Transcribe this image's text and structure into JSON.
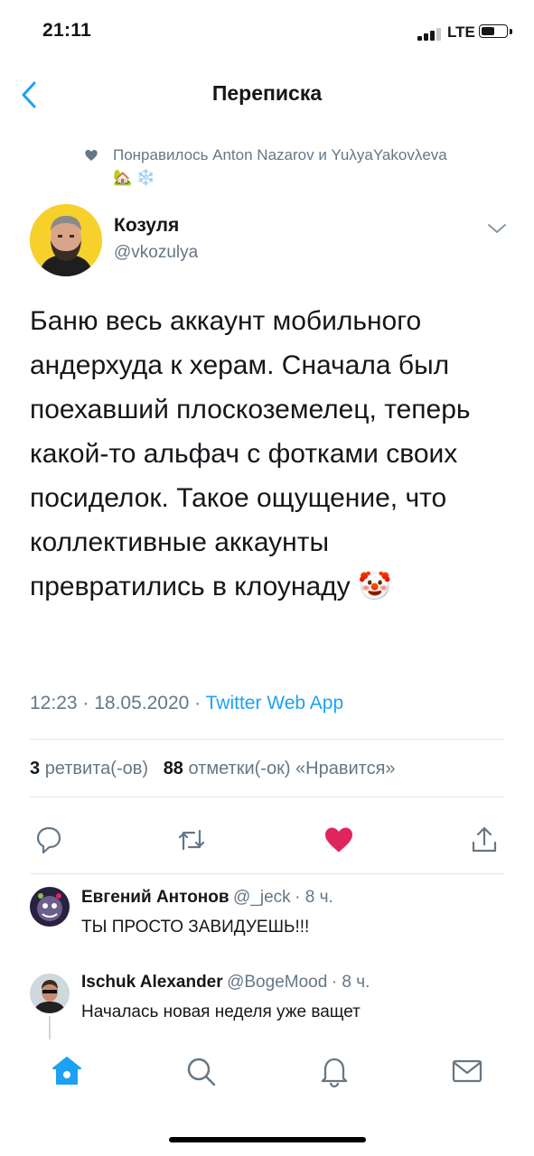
{
  "status_bar": {
    "time": "21:11",
    "network": "LTE",
    "signal_bars": 3,
    "battery_level": 0.55
  },
  "nav": {
    "back_icon": "chevron-left-icon",
    "title": "Переписка"
  },
  "liked_by": {
    "text": "Понравилось Anton Nazarov и YuλyaYakovλeva 🏡 ❄️",
    "icon": "heart-icon"
  },
  "tweet": {
    "author_name": "Козуля",
    "handle": "@vkozulya",
    "text": "Баню весь аккаунт мобильного андерхуда к херам. Сначала был поехавший плоскоземелец, теперь какой-то альфач с фотками своих посиделок. Такое ощущение, что коллективные аккаунты превратились в клоунаду 🤡",
    "time_date": "12:23 · 18.05.2020 · ",
    "source": "Twitter Web App",
    "retweets_count": "3",
    "retweets_label": "ретвита(-ов)",
    "likes_count": "88",
    "likes_label": "отметки(-ок) «Нравится»"
  },
  "actions": [
    "reply-icon",
    "retweet-icon",
    "like-icon",
    "share-icon"
  ],
  "colors": {
    "accent": "#1da1f2",
    "like": "#e0245e",
    "secondary_text": "#657786",
    "divider": "#e1e8ed"
  },
  "replies": [
    {
      "name": "Евгений Антонов",
      "handle": "@_jeck",
      "time": "· 8 ч.",
      "text": "ТЫ ПРОСТО ЗАВИДУЕШЬ!!!"
    },
    {
      "name": "Ischuk Alexander",
      "handle": "@BogeMood",
      "time": "· 8 ч.",
      "text": "Началась новая неделя уже ващет"
    }
  ],
  "tab_bar": [
    "home-icon",
    "search-icon",
    "notifications-icon",
    "messages-icon"
  ]
}
